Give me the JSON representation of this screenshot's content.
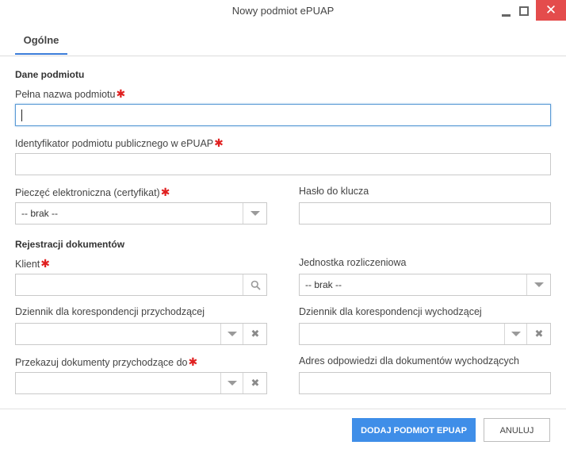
{
  "window": {
    "title": "Nowy podmiot ePUAP",
    "close_glyph": "✕",
    "colors": {
      "close_bg": "#e44c4c",
      "accent": "#3f8ee8",
      "required": "#e02020"
    }
  },
  "tabs": [
    {
      "label": "Ogólne",
      "active": true
    }
  ],
  "sections": {
    "entity_data": "Dane podmiotu",
    "document_registration": "Rejestracji dokumentów"
  },
  "fields": {
    "full_name": {
      "label": "Pełna nazwa podmiotu",
      "required": true,
      "value": ""
    },
    "public_entity_id": {
      "label": "Identyfikator podmiotu publicznego w ePUAP",
      "required": true,
      "value": ""
    },
    "e_seal": {
      "label": "Pieczęć elektroniczna (certyfikat)",
      "required": true,
      "value": "-- brak --"
    },
    "key_password": {
      "label": "Hasło do klucza",
      "required": false,
      "value": ""
    },
    "client": {
      "label": "Klient",
      "required": true,
      "value": ""
    },
    "billing_unit": {
      "label": "Jednostka rozliczeniowa",
      "required": false,
      "value": "-- brak --"
    },
    "incoming_journal": {
      "label": "Dziennik dla korespondencji przychodzącej",
      "required": false,
      "value": ""
    },
    "outgoing_journal": {
      "label": "Dziennik dla korespondencji wychodzącej",
      "required": false,
      "value": ""
    },
    "forward_incoming": {
      "label": "Przekazuj dokumenty przychodzące do",
      "required": true,
      "value": ""
    },
    "reply_address": {
      "label": "Adres odpowiedzi dla dokumentów wychodzących",
      "required": false,
      "value": ""
    }
  },
  "required_marker": "✱",
  "clear_glyph": "✖",
  "buttons": {
    "submit": "DODAJ PODMIOT EPUAP",
    "cancel": "ANULUJ"
  }
}
